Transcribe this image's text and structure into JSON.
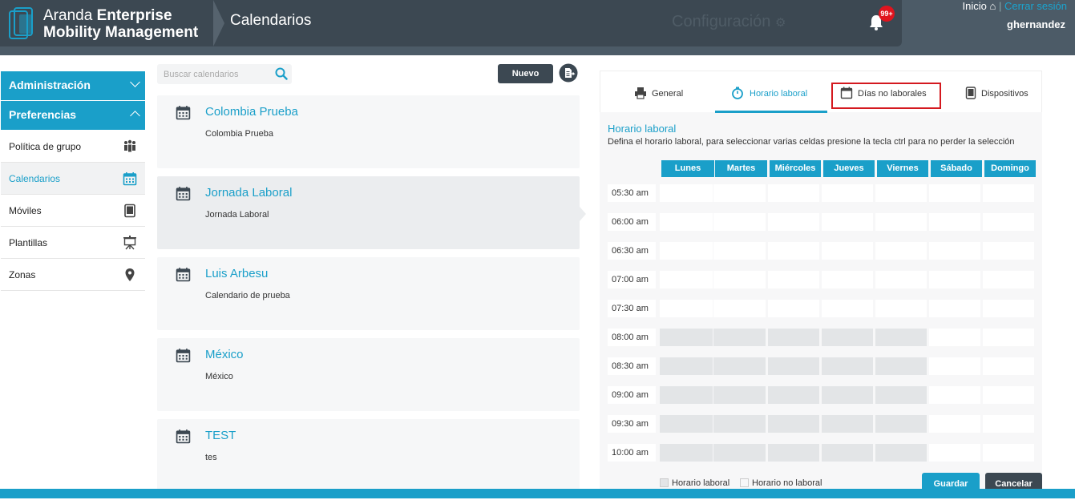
{
  "header": {
    "brand_light": "Aranda",
    "brand_bold_1": "Enterprise",
    "brand_bold_2": "Mobility Management",
    "page_title": "Calendarios",
    "config_label": "Configuración",
    "notification_count": "99+",
    "inicio": "Inicio",
    "cerrar_sesion": "Cerrar sesión",
    "username": "ghernandez"
  },
  "sidebar": {
    "sections": [
      {
        "label": "Administración"
      },
      {
        "label": "Preferencias"
      }
    ],
    "items": [
      {
        "label": "Política de grupo",
        "icon": "group-icon"
      },
      {
        "label": "Calendarios",
        "icon": "calendar-icon"
      },
      {
        "label": "Móviles",
        "icon": "tablet-icon"
      },
      {
        "label": "Plantillas",
        "icon": "presentation-icon"
      },
      {
        "label": "Zonas",
        "icon": "map-pin-icon"
      }
    ]
  },
  "search": {
    "placeholder": "Buscar calendarios"
  },
  "toolbar": {
    "nuevo_label": "Nuevo"
  },
  "calendars": [
    {
      "name": "Colombia Prueba",
      "desc": "Colombia Prueba"
    },
    {
      "name": "Jornada Laboral",
      "desc": "Jornada Laboral"
    },
    {
      "name": "Luis Arbesu",
      "desc": "Calendario de prueba"
    },
    {
      "name": "México",
      "desc": "México"
    },
    {
      "name": "TEST",
      "desc": "tes"
    }
  ],
  "tabs": [
    {
      "label": "General"
    },
    {
      "label": "Horario laboral"
    },
    {
      "label": "Días no laborales"
    },
    {
      "label": "Dispositivos"
    }
  ],
  "schedule": {
    "title": "Horario laboral",
    "description": "Defina el horario laboral, para seleccionar varias celdas presione la tecla ctrl para no perder la selección",
    "days": [
      "Lunes",
      "Martes",
      "Miércoles",
      "Jueves",
      "Viernes",
      "Sábado",
      "Domingo"
    ],
    "times": [
      "05:30 am",
      "06:00 am",
      "06:30 am",
      "07:00 am",
      "07:30 am",
      "08:00 am",
      "08:30 am",
      "09:00 am",
      "09:30 am",
      "10:00 am"
    ],
    "working": [
      [
        0,
        0,
        0,
        0,
        0,
        0,
        0
      ],
      [
        0,
        0,
        0,
        0,
        0,
        0,
        0
      ],
      [
        0,
        0,
        0,
        0,
        0,
        0,
        0
      ],
      [
        0,
        0,
        0,
        0,
        0,
        0,
        0
      ],
      [
        0,
        0,
        0,
        0,
        0,
        0,
        0
      ],
      [
        1,
        1,
        1,
        1,
        1,
        0,
        0
      ],
      [
        1,
        1,
        1,
        1,
        1,
        0,
        0
      ],
      [
        1,
        1,
        1,
        1,
        1,
        0,
        0
      ],
      [
        1,
        1,
        1,
        1,
        1,
        0,
        0
      ],
      [
        1,
        1,
        1,
        1,
        1,
        0,
        0
      ]
    ],
    "legend_working": "Horario laboral",
    "legend_nonworking": "Horario no laboral"
  },
  "actions": {
    "guardar": "Guardar",
    "cancelar": "Cancelar"
  },
  "colors": {
    "accent": "#1a9fc9",
    "dark": "#3c4852",
    "highlight": "#d4191f"
  }
}
